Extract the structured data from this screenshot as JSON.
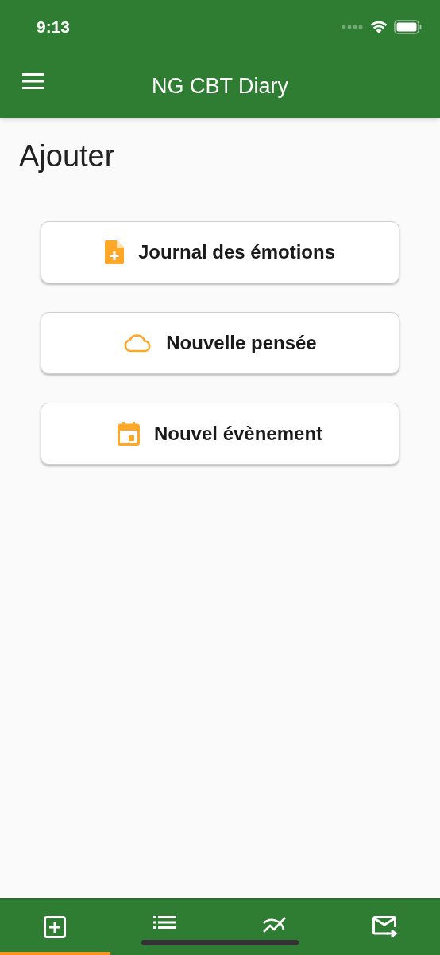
{
  "status_bar": {
    "time": "9:13"
  },
  "app_bar": {
    "title": "NG CBT Diary"
  },
  "heading": "Ajouter",
  "actions": [
    {
      "kind": "document",
      "label": "Journal des émotions"
    },
    {
      "kind": "cloud",
      "label": "Nouvelle pensée"
    },
    {
      "kind": "calendar",
      "label": "Nouvel évènement"
    }
  ],
  "bottom_tabs": [
    {
      "kind": "add",
      "selected": true
    },
    {
      "kind": "list",
      "selected": false
    },
    {
      "kind": "chart",
      "selected": false
    },
    {
      "kind": "mail",
      "selected": false
    }
  ]
}
